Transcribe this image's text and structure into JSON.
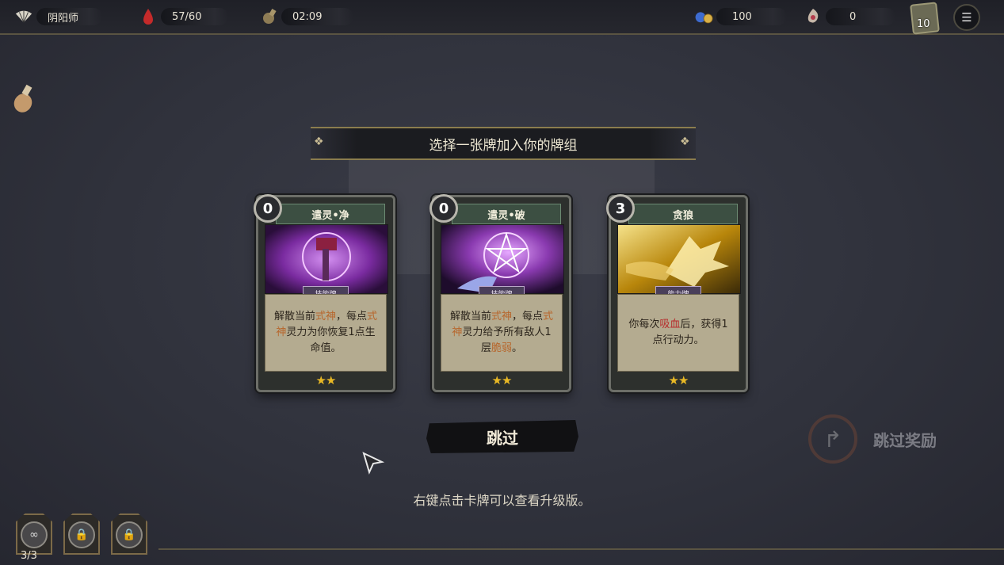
{
  "topbar": {
    "player_name": "阴阳师",
    "hp": "57/60",
    "time": "02:09",
    "gold": "100",
    "souls": "0",
    "deck_count": "10"
  },
  "banner": {
    "title": "选择一张牌加入你的牌组"
  },
  "cards": [
    {
      "cost": "0",
      "name": "遣灵•净",
      "type": "技能牌",
      "text_parts": [
        "解散当前",
        "式神",
        "，每点",
        "式神",
        "灵力为你恢复1点生命值。"
      ],
      "stars": "★★"
    },
    {
      "cost": "0",
      "name": "遣灵•破",
      "type": "技能牌",
      "text_parts": [
        "解散当前",
        "式神",
        "，每点",
        "式神",
        "灵力给予所有敌人1层",
        "脆弱",
        "。"
      ],
      "stars": "★★"
    },
    {
      "cost": "3",
      "name": "贪狼",
      "type": "能力牌",
      "text_parts": [
        "你每次",
        "吸血",
        "后，获得1点行动力。"
      ],
      "stars": "★★"
    }
  ],
  "skip_label": "跳过",
  "skip_reward_label": "跳过奖励",
  "hint": "右键点击卡牌可以查看升级版。",
  "slots": {
    "count": "3/3"
  },
  "colors": {
    "highlight_orange": "#b7662c",
    "highlight_red": "#b72b2b",
    "star": "#e8b825"
  },
  "icons": [
    "fan-icon",
    "blood-drop-icon",
    "hourglass-icon",
    "coin-pouch-icon",
    "soul-icon",
    "deck-icon",
    "menu-icon",
    "potion-icon",
    "lock-icon"
  ]
}
